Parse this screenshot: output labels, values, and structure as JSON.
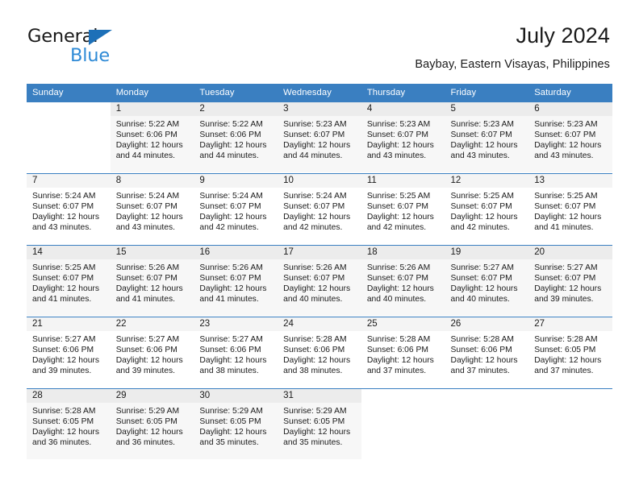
{
  "logo": {
    "word1": "General",
    "word2": "Blue",
    "triangle_color": "#1d70b8",
    "blue_color": "#2e8ad6"
  },
  "header": {
    "title": "July 2024",
    "subtitle": "Baybay, Eastern Visayas, Philippines",
    "header_bg": "#3a7fc1"
  },
  "weekday_headers": [
    "Sunday",
    "Monday",
    "Tuesday",
    "Wednesday",
    "Thursday",
    "Friday",
    "Saturday"
  ],
  "weeks": [
    {
      "shaded": true,
      "days": [
        {
          "num": "",
          "sunrise": "",
          "sunset": "",
          "daylight_1": "",
          "daylight_2": "",
          "empty": true
        },
        {
          "num": "1",
          "sunrise": "Sunrise: 5:22 AM",
          "sunset": "Sunset: 6:06 PM",
          "daylight_1": "Daylight: 12 hours",
          "daylight_2": "and 44 minutes."
        },
        {
          "num": "2",
          "sunrise": "Sunrise: 5:22 AM",
          "sunset": "Sunset: 6:06 PM",
          "daylight_1": "Daylight: 12 hours",
          "daylight_2": "and 44 minutes."
        },
        {
          "num": "3",
          "sunrise": "Sunrise: 5:23 AM",
          "sunset": "Sunset: 6:07 PM",
          "daylight_1": "Daylight: 12 hours",
          "daylight_2": "and 44 minutes."
        },
        {
          "num": "4",
          "sunrise": "Sunrise: 5:23 AM",
          "sunset": "Sunset: 6:07 PM",
          "daylight_1": "Daylight: 12 hours",
          "daylight_2": "and 43 minutes."
        },
        {
          "num": "5",
          "sunrise": "Sunrise: 5:23 AM",
          "sunset": "Sunset: 6:07 PM",
          "daylight_1": "Daylight: 12 hours",
          "daylight_2": "and 43 minutes."
        },
        {
          "num": "6",
          "sunrise": "Sunrise: 5:23 AM",
          "sunset": "Sunset: 6:07 PM",
          "daylight_1": "Daylight: 12 hours",
          "daylight_2": "and 43 minutes."
        }
      ]
    },
    {
      "shaded": false,
      "days": [
        {
          "num": "7",
          "sunrise": "Sunrise: 5:24 AM",
          "sunset": "Sunset: 6:07 PM",
          "daylight_1": "Daylight: 12 hours",
          "daylight_2": "and 43 minutes."
        },
        {
          "num": "8",
          "sunrise": "Sunrise: 5:24 AM",
          "sunset": "Sunset: 6:07 PM",
          "daylight_1": "Daylight: 12 hours",
          "daylight_2": "and 43 minutes."
        },
        {
          "num": "9",
          "sunrise": "Sunrise: 5:24 AM",
          "sunset": "Sunset: 6:07 PM",
          "daylight_1": "Daylight: 12 hours",
          "daylight_2": "and 42 minutes."
        },
        {
          "num": "10",
          "sunrise": "Sunrise: 5:24 AM",
          "sunset": "Sunset: 6:07 PM",
          "daylight_1": "Daylight: 12 hours",
          "daylight_2": "and 42 minutes."
        },
        {
          "num": "11",
          "sunrise": "Sunrise: 5:25 AM",
          "sunset": "Sunset: 6:07 PM",
          "daylight_1": "Daylight: 12 hours",
          "daylight_2": "and 42 minutes."
        },
        {
          "num": "12",
          "sunrise": "Sunrise: 5:25 AM",
          "sunset": "Sunset: 6:07 PM",
          "daylight_1": "Daylight: 12 hours",
          "daylight_2": "and 42 minutes."
        },
        {
          "num": "13",
          "sunrise": "Sunrise: 5:25 AM",
          "sunset": "Sunset: 6:07 PM",
          "daylight_1": "Daylight: 12 hours",
          "daylight_2": "and 41 minutes."
        }
      ]
    },
    {
      "shaded": true,
      "days": [
        {
          "num": "14",
          "sunrise": "Sunrise: 5:25 AM",
          "sunset": "Sunset: 6:07 PM",
          "daylight_1": "Daylight: 12 hours",
          "daylight_2": "and 41 minutes."
        },
        {
          "num": "15",
          "sunrise": "Sunrise: 5:26 AM",
          "sunset": "Sunset: 6:07 PM",
          "daylight_1": "Daylight: 12 hours",
          "daylight_2": "and 41 minutes."
        },
        {
          "num": "16",
          "sunrise": "Sunrise: 5:26 AM",
          "sunset": "Sunset: 6:07 PM",
          "daylight_1": "Daylight: 12 hours",
          "daylight_2": "and 41 minutes."
        },
        {
          "num": "17",
          "sunrise": "Sunrise: 5:26 AM",
          "sunset": "Sunset: 6:07 PM",
          "daylight_1": "Daylight: 12 hours",
          "daylight_2": "and 40 minutes."
        },
        {
          "num": "18",
          "sunrise": "Sunrise: 5:26 AM",
          "sunset": "Sunset: 6:07 PM",
          "daylight_1": "Daylight: 12 hours",
          "daylight_2": "and 40 minutes."
        },
        {
          "num": "19",
          "sunrise": "Sunrise: 5:27 AM",
          "sunset": "Sunset: 6:07 PM",
          "daylight_1": "Daylight: 12 hours",
          "daylight_2": "and 40 minutes."
        },
        {
          "num": "20",
          "sunrise": "Sunrise: 5:27 AM",
          "sunset": "Sunset: 6:07 PM",
          "daylight_1": "Daylight: 12 hours",
          "daylight_2": "and 39 minutes."
        }
      ]
    },
    {
      "shaded": false,
      "days": [
        {
          "num": "21",
          "sunrise": "Sunrise: 5:27 AM",
          "sunset": "Sunset: 6:06 PM",
          "daylight_1": "Daylight: 12 hours",
          "daylight_2": "and 39 minutes."
        },
        {
          "num": "22",
          "sunrise": "Sunrise: 5:27 AM",
          "sunset": "Sunset: 6:06 PM",
          "daylight_1": "Daylight: 12 hours",
          "daylight_2": "and 39 minutes."
        },
        {
          "num": "23",
          "sunrise": "Sunrise: 5:27 AM",
          "sunset": "Sunset: 6:06 PM",
          "daylight_1": "Daylight: 12 hours",
          "daylight_2": "and 38 minutes."
        },
        {
          "num": "24",
          "sunrise": "Sunrise: 5:28 AM",
          "sunset": "Sunset: 6:06 PM",
          "daylight_1": "Daylight: 12 hours",
          "daylight_2": "and 38 minutes."
        },
        {
          "num": "25",
          "sunrise": "Sunrise: 5:28 AM",
          "sunset": "Sunset: 6:06 PM",
          "daylight_1": "Daylight: 12 hours",
          "daylight_2": "and 37 minutes."
        },
        {
          "num": "26",
          "sunrise": "Sunrise: 5:28 AM",
          "sunset": "Sunset: 6:06 PM",
          "daylight_1": "Daylight: 12 hours",
          "daylight_2": "and 37 minutes."
        },
        {
          "num": "27",
          "sunrise": "Sunrise: 5:28 AM",
          "sunset": "Sunset: 6:05 PM",
          "daylight_1": "Daylight: 12 hours",
          "daylight_2": "and 37 minutes."
        }
      ]
    },
    {
      "shaded": true,
      "days": [
        {
          "num": "28",
          "sunrise": "Sunrise: 5:28 AM",
          "sunset": "Sunset: 6:05 PM",
          "daylight_1": "Daylight: 12 hours",
          "daylight_2": "and 36 minutes."
        },
        {
          "num": "29",
          "sunrise": "Sunrise: 5:29 AM",
          "sunset": "Sunset: 6:05 PM",
          "daylight_1": "Daylight: 12 hours",
          "daylight_2": "and 36 minutes."
        },
        {
          "num": "30",
          "sunrise": "Sunrise: 5:29 AM",
          "sunset": "Sunset: 6:05 PM",
          "daylight_1": "Daylight: 12 hours",
          "daylight_2": "and 35 minutes."
        },
        {
          "num": "31",
          "sunrise": "Sunrise: 5:29 AM",
          "sunset": "Sunset: 6:05 PM",
          "daylight_1": "Daylight: 12 hours",
          "daylight_2": "and 35 minutes."
        },
        {
          "num": "",
          "sunrise": "",
          "sunset": "",
          "daylight_1": "",
          "daylight_2": "",
          "empty": true
        },
        {
          "num": "",
          "sunrise": "",
          "sunset": "",
          "daylight_1": "",
          "daylight_2": "",
          "empty": true
        },
        {
          "num": "",
          "sunrise": "",
          "sunset": "",
          "daylight_1": "",
          "daylight_2": "",
          "empty": true
        }
      ]
    }
  ]
}
